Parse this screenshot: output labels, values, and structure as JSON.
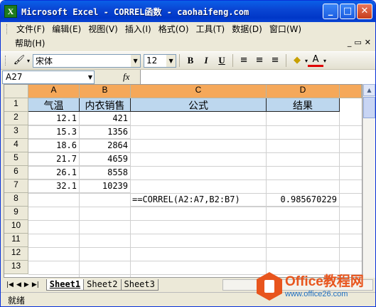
{
  "window": {
    "title": "Microsoft Excel - CORREL函数 - caohaifeng.com",
    "app_icon": "X"
  },
  "menu": {
    "items": [
      "文件(F)",
      "编辑(E)",
      "视图(V)",
      "插入(I)",
      "格式(O)",
      "工具(T)",
      "数据(D)",
      "窗口(W)"
    ],
    "help": "帮助(H)"
  },
  "toolbar": {
    "font": "宋体",
    "size": "12",
    "bold": "B",
    "italic": "I",
    "underline": "U",
    "font_color_label": "A"
  },
  "formula_bar": {
    "namebox": "A27",
    "fx": "fx",
    "content": ""
  },
  "columns": [
    "A",
    "B",
    "C",
    "D"
  ],
  "rows": [
    "1",
    "2",
    "3",
    "4",
    "5",
    "6",
    "7",
    "8",
    "9",
    "10",
    "11",
    "12",
    "13"
  ],
  "table": {
    "headers": [
      "气温",
      "内衣销售",
      "公式",
      "结果"
    ],
    "data": [
      [
        "12.1",
        "421"
      ],
      [
        "15.3",
        "1356"
      ],
      [
        "18.6",
        "2864"
      ],
      [
        "21.7",
        "4659"
      ],
      [
        "26.1",
        "8558"
      ],
      [
        "32.1",
        "10239"
      ]
    ],
    "formula": "==CORREL(A2:A7,B2:B7)",
    "result": "0.985670229"
  },
  "sheets": [
    "Sheet1",
    "Sheet2",
    "Sheet3"
  ],
  "status": "就绪",
  "watermark": {
    "brand": "Office教程网",
    "url": "www.office26.com"
  },
  "colors": {
    "title_blue": "#0a46d4",
    "header_fill": "#bdd7ee",
    "accent": "#e8551d"
  }
}
